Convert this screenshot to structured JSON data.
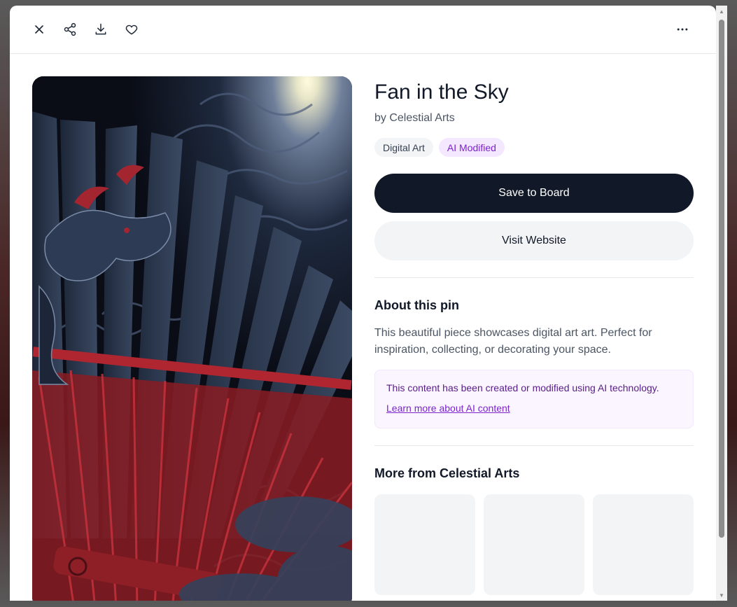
{
  "toolbar": {
    "close_icon": "close-icon",
    "share_icon": "share-icon",
    "download_icon": "download-icon",
    "favorite_icon": "heart-icon",
    "more_icon": "more-horizontal-icon"
  },
  "pin": {
    "title": "Fan in the Sky",
    "author": "by Celestial Arts",
    "tags": [
      "Digital Art",
      "AI Modified"
    ]
  },
  "actions": {
    "save_label": "Save to Board",
    "visit_label": "Visit Website"
  },
  "about": {
    "heading": "About this pin",
    "description": "This beautiful piece showcases digital art art. Perfect for inspiration, collecting, or decorating your space."
  },
  "ai_notice": {
    "text": "This content has been created or modified using AI technology.",
    "link": "Learn more about AI content"
  },
  "more_from": {
    "heading": "More from Celestial Arts",
    "thumbnail_count": 3
  },
  "colors": {
    "primary_button": "#111827",
    "ai_accent": "#7e22ce",
    "ai_background": "#faf5ff"
  }
}
